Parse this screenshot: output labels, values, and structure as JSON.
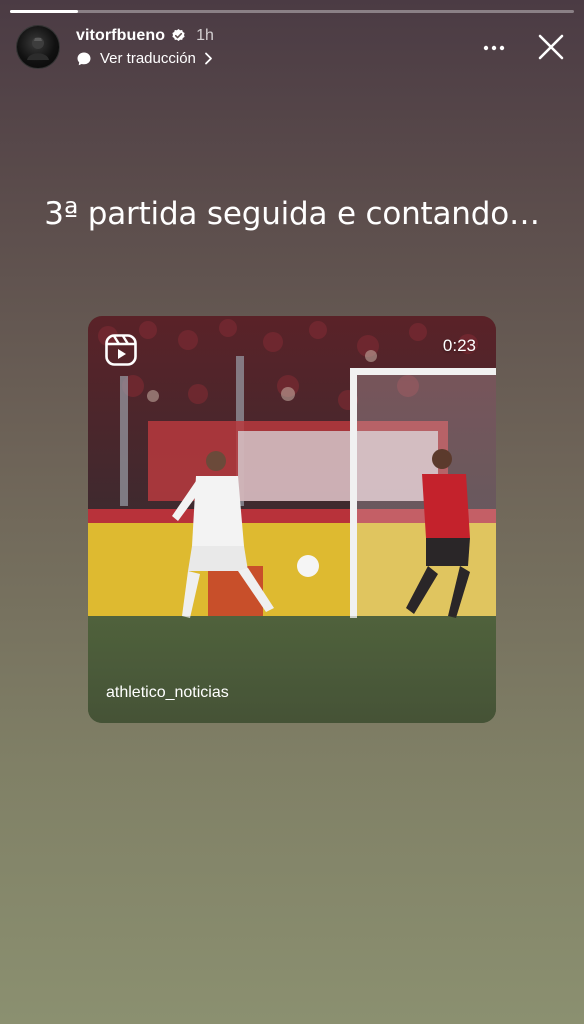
{
  "story": {
    "progress": 0.12
  },
  "header": {
    "username": "vitorfbueno",
    "time": "1h",
    "translate_label": "Ver traducción",
    "verified": true
  },
  "caption": "3ª partida seguida e contando…",
  "reel": {
    "duration": "0:23",
    "author": "athletico_noticias"
  },
  "icons": {
    "avatar": "profile-photo",
    "verified": "verified-badge-icon",
    "translate": "speech-bubble-icon",
    "chevron": "chevron-right-icon",
    "more": "more-dots-icon",
    "close": "close-icon",
    "reel": "reels-icon"
  },
  "colors": {
    "bg_top": "#4b3b44",
    "bg_bottom": "#8b9070",
    "text": "#ffffff"
  }
}
